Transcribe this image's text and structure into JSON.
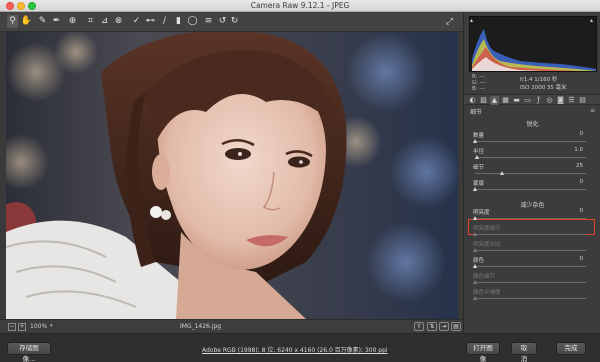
{
  "window": {
    "title": "Camera Raw 9.12.1 - JPEG"
  },
  "toolbar": {
    "tools": [
      "zoom-icon",
      "hand-icon",
      "white-balance-icon",
      "color-sampler-icon",
      "target-adjust-icon",
      "crop-icon",
      "straighten-icon",
      "spot-removal-icon",
      "red-eye-icon",
      "adjustment-brush-icon",
      "graduated-filter-icon",
      "radial-filter-icon",
      "preferences-icon",
      "rotate-ccw-icon",
      "rotate-cw-icon"
    ],
    "right_tool": "fullscreen-icon"
  },
  "histogram": {
    "rgb_labels": [
      "R:",
      "G:",
      "B:"
    ],
    "rgb_values": [
      "---",
      "---",
      "---"
    ],
    "aperture_shutter": "f/1.4   1/160 秒",
    "iso_focal": "ISO 2000   35 毫米"
  },
  "panel": {
    "title": "细节",
    "sharpen_title": "锐化",
    "noise_title": "减少杂色",
    "sharpen_sliders": [
      {
        "label": "数量",
        "value": "0",
        "pos": 0.0,
        "enabled": true
      },
      {
        "label": "半径",
        "value": "1.0",
        "pos": 0.02,
        "enabled": true
      },
      {
        "label": "细节",
        "value": "25",
        "pos": 0.25,
        "enabled": true
      },
      {
        "label": "蒙版",
        "value": "0",
        "pos": 0.0,
        "enabled": true
      }
    ],
    "noise_sliders": [
      {
        "label": "明亮度",
        "value": "0",
        "pos": 0.0,
        "enabled": true
      },
      {
        "label": "明亮度细节",
        "value": "",
        "pos": 0.0,
        "enabled": false
      },
      {
        "label": "明亮度对比",
        "value": "",
        "pos": 0.0,
        "enabled": false
      },
      {
        "label": "颜色",
        "value": "0",
        "pos": 0.0,
        "enabled": true
      },
      {
        "label": "颜色细节",
        "value": "",
        "pos": 0.0,
        "enabled": false
      },
      {
        "label": "颜色平滑度",
        "value": "",
        "pos": 0.0,
        "enabled": false
      }
    ]
  },
  "footer": {
    "zoom": "100%",
    "filename": "IMG_1426.jpg"
  },
  "bottombar": {
    "save_label": "存储图像...",
    "workflow_link": "Adobe RGB (1998); 8 位; 6240 x 4160 (26.0 百万像素); 300 ppi",
    "open_label": "打开图像",
    "cancel_label": "取消",
    "done_label": "完成"
  }
}
